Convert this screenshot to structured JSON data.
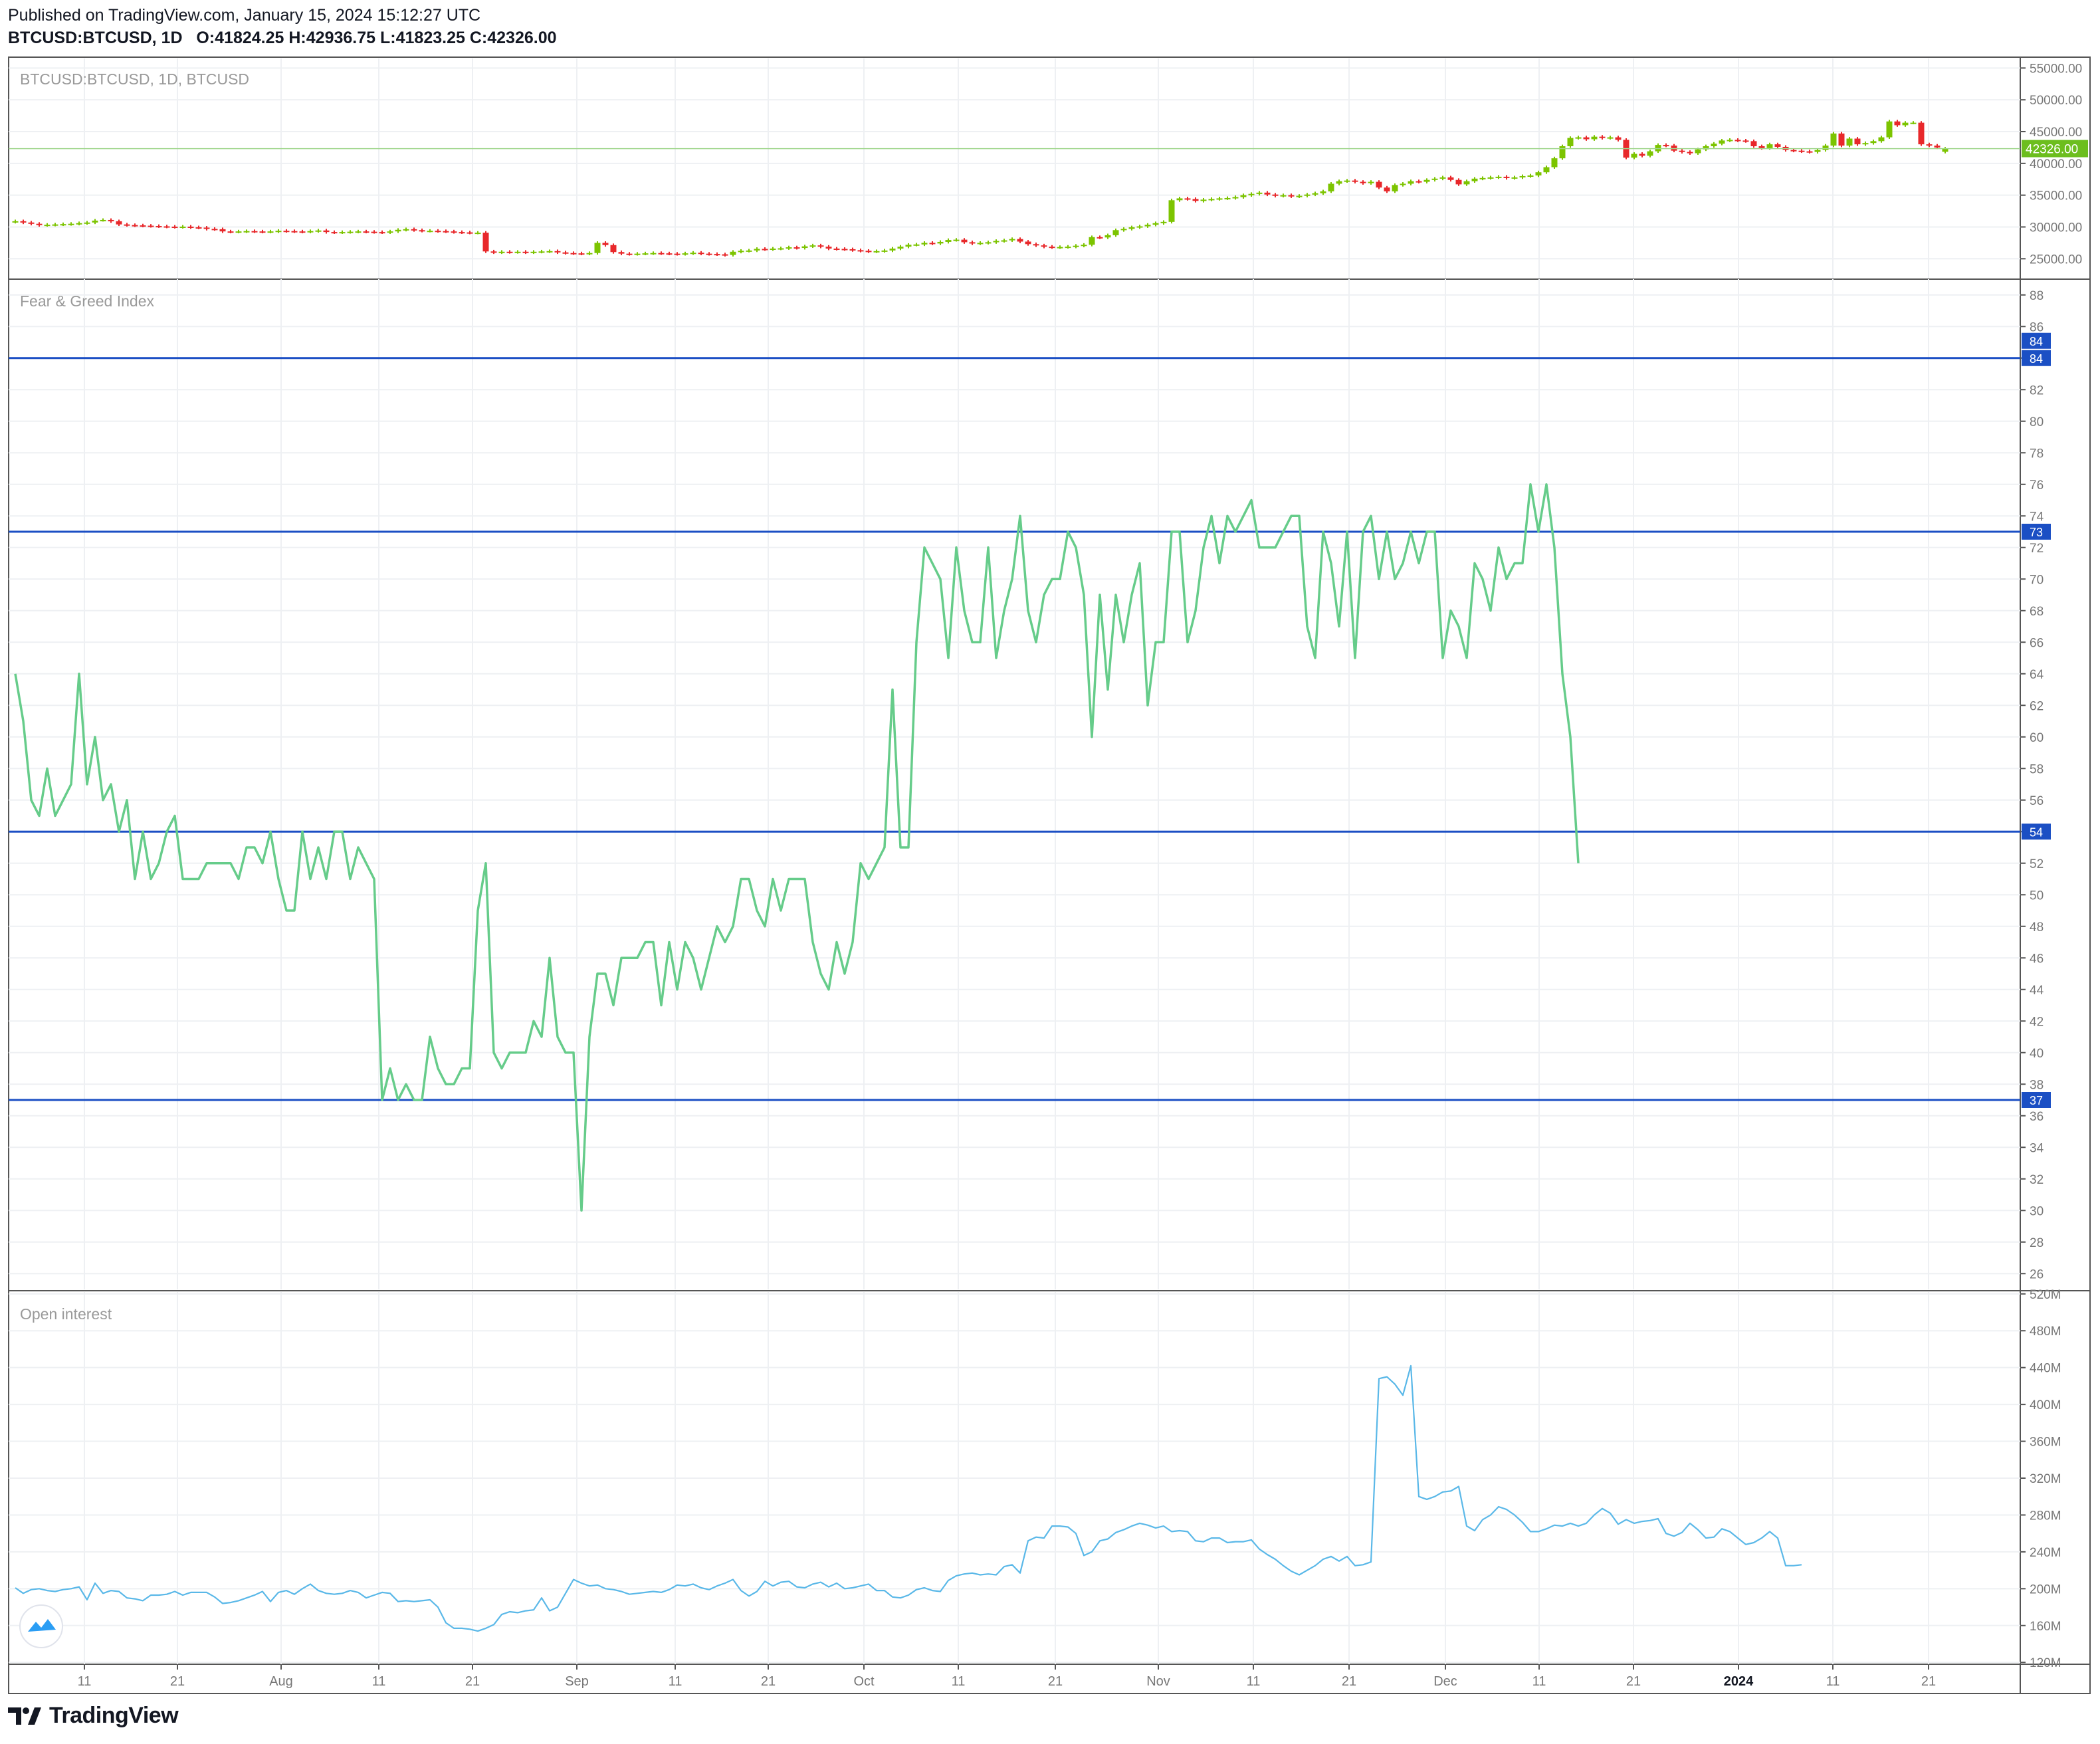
{
  "header": {
    "published": "Published on TradingView.com, January 15, 2024 15:12:27 UTC",
    "symbol": "BTCUSD:BTCUSD, 1D",
    "open_label": "O:",
    "open": "41824.25",
    "high_label": "H:",
    "high": "42936.75",
    "low_label": "L:",
    "low": "41823.25",
    "close_label": "C:",
    "close": "42326.00"
  },
  "footer": {
    "brand": "TradingView",
    "logo_icon": "tradingview-logo-icon"
  },
  "colors": {
    "up": "#7cc400",
    "down": "#e8282b",
    "fg_line": "#66cc8a",
    "hline": "#1b4fc4",
    "oi_line": "#5ab8e8",
    "grid": "#eef0f3",
    "border": "#555555",
    "axis_text": "#777777",
    "price_tag": "#6cbe1e"
  },
  "chart_data": [
    {
      "type": "candlestick",
      "title": "BTCUSD:BTCUSD, 1D, BTCUSD",
      "ylim": [
        22000,
        56500
      ],
      "y_ticks": [
        "25000.00",
        "30000.00",
        "35000.00",
        "40000.00",
        "45000.00",
        "50000.00",
        "55000.00"
      ],
      "last_price_label": "42326.00",
      "last_price": 42326,
      "closes": [
        30900,
        30700,
        30500,
        30300,
        30350,
        30400,
        30450,
        30500,
        30600,
        30700,
        31000,
        31100,
        30900,
        30400,
        30300,
        30250,
        30200,
        30150,
        30100,
        30050,
        30000,
        30050,
        29950,
        29900,
        29700,
        29650,
        29300,
        29250,
        29300,
        29350,
        29300,
        29250,
        29300,
        29400,
        29350,
        29300,
        29250,
        29350,
        29450,
        29200,
        29150,
        29200,
        29250,
        29300,
        29250,
        29200,
        29150,
        29300,
        29550,
        29650,
        29500,
        29400,
        29400,
        29350,
        29300,
        29200,
        29150,
        29100,
        29100,
        26150,
        26000,
        26100,
        26050,
        26100,
        26000,
        26100,
        26150,
        26200,
        26000,
        25900,
        25850,
        25800,
        25900,
        27500,
        27150,
        26050,
        25800,
        25750,
        25800,
        25850,
        25900,
        25850,
        25800,
        25750,
        25850,
        25950,
        25800,
        25750,
        25700,
        25600,
        26100,
        26250,
        26300,
        26550,
        26500,
        26600,
        26650,
        26800,
        26700,
        26950,
        27100,
        26900,
        26600,
        26550,
        26500,
        26350,
        26250,
        26150,
        26200,
        26300,
        26600,
        26900,
        27200,
        27250,
        27500,
        27400,
        27650,
        27950,
        28000,
        27600,
        27400,
        27500,
        27600,
        27800,
        27900,
        28100,
        27700,
        27300,
        27100,
        26900,
        26800,
        26850,
        26900,
        27050,
        27200,
        28400,
        28350,
        28700,
        29500,
        29700,
        29950,
        30100,
        30350,
        30600,
        30800,
        34200,
        34500,
        34400,
        34100,
        34300,
        34400,
        34500,
        34550,
        34700,
        35000,
        35200,
        35400,
        35100,
        34900,
        35000,
        34800,
        34900,
        35100,
        35300,
        35600,
        36800,
        37200,
        37300,
        37100,
        36900,
        37100,
        36200,
        35600,
        36600,
        36800,
        37200,
        37100,
        37400,
        37600,
        37800,
        37400,
        36700,
        37200,
        37600,
        37700,
        37800,
        37900,
        37700,
        37800,
        38000,
        38100,
        38600,
        39400,
        40800,
        42700,
        44000,
        44100,
        43800,
        44200,
        44000,
        44100,
        43700,
        40900,
        41500,
        41200,
        41900,
        42900,
        42800,
        42000,
        41800,
        41600,
        42200,
        42700,
        43100,
        43600,
        43700,
        43600,
        43500,
        42700,
        42400,
        43000,
        42600,
        42100,
        42000,
        41900,
        41800,
        42100,
        42800,
        44700,
        42800,
        43900,
        43000,
        43200,
        43500,
        44100,
        46600,
        46000,
        46400,
        46400,
        43000,
        42800,
        42500,
        42326
      ],
      "opens": [
        30800,
        30900,
        30700,
        30500,
        30300,
        30350,
        30400,
        30450,
        30500,
        30600,
        30700,
        31100,
        31100,
        30900,
        30400,
        30300,
        30250,
        30200,
        30150,
        30100,
        30050,
        30000,
        30050,
        29950,
        29900,
        29700,
        29650,
        29300,
        29250,
        29300,
        29350,
        29300,
        29250,
        29300,
        29400,
        29350,
        29300,
        29250,
        29350,
        29450,
        29200,
        29150,
        29200,
        29250,
        29300,
        29250,
        29200,
        29150,
        29300,
        29550,
        29650,
        29500,
        29400,
        29400,
        29350,
        29300,
        29200,
        29150,
        29100,
        29100,
        26150,
        26000,
        26100,
        26050,
        26100,
        26000,
        26100,
        26150,
        26200,
        26000,
        25900,
        25850,
        25800,
        25900,
        27500,
        27150,
        26050,
        25800,
        25750,
        25800,
        25850,
        25900,
        25850,
        25800,
        25750,
        25850,
        25950,
        25800,
        25750,
        25700,
        25600,
        26100,
        26250,
        26300,
        26550,
        26500,
        26600,
        26650,
        26800,
        26700,
        26950,
        27100,
        26900,
        26600,
        26550,
        26500,
        26350,
        26250,
        26150,
        26200,
        26300,
        26600,
        26900,
        27200,
        27250,
        27500,
        27400,
        27650,
        27950,
        28000,
        27600,
        27400,
        27500,
        27600,
        27800,
        27900,
        28100,
        27700,
        27300,
        27100,
        26900,
        26800,
        26850,
        26900,
        27050,
        27200,
        28400,
        28350,
        28700,
        29500,
        29700,
        29950,
        30100,
        30350,
        30600,
        30800,
        34200,
        34500,
        34400,
        34100,
        34300,
        34400,
        34500,
        34550,
        34700,
        35000,
        35200,
        35400,
        35100,
        34900,
        35000,
        34800,
        34900,
        35100,
        35300,
        35600,
        36800,
        37200,
        37300,
        37100,
        36900,
        37100,
        36200,
        35600,
        36600,
        36800,
        37200,
        37100,
        37400,
        37600,
        37800,
        37400,
        36700,
        37200,
        37600,
        37700,
        37800,
        37900,
        37700,
        37800,
        38000,
        38100,
        38600,
        39400,
        40800,
        42700,
        44000,
        44100,
        43800,
        44200,
        44000,
        44100,
        43700,
        40900,
        41500,
        41200,
        41900,
        42900,
        42800,
        42000,
        41800,
        41600,
        42200,
        42700,
        43100,
        43600,
        43700,
        43600,
        43500,
        42700,
        42400,
        43000,
        42600,
        42100,
        42000,
        41900,
        41800,
        42100,
        42800,
        44700,
        42800,
        43900,
        43000,
        43200,
        43500,
        44100,
        46600,
        46000,
        46400,
        46400,
        43000,
        42800,
        41824
      ]
    },
    {
      "type": "line",
      "title": "Fear & Greed Index",
      "ylim": [
        25,
        89
      ],
      "y_ticks": [
        26,
        28,
        30,
        32,
        34,
        36,
        38,
        40,
        42,
        44,
        46,
        48,
        50,
        52,
        54,
        56,
        58,
        60,
        62,
        64,
        66,
        68,
        70,
        72,
        74,
        76,
        78,
        80,
        82,
        84,
        86,
        88
      ],
      "horizontal_lines": [
        {
          "value": 84,
          "label": "84"
        },
        {
          "value": 73,
          "label": "73"
        },
        {
          "value": 54,
          "label": "54"
        },
        {
          "value": 37,
          "label": "37"
        }
      ],
      "extra_tags": [
        "84"
      ],
      "values": [
        64,
        61,
        56,
        55,
        58,
        55,
        56,
        57,
        64,
        57,
        60,
        56,
        57,
        54,
        56,
        51,
        54,
        51,
        52,
        54,
        55,
        51,
        51,
        51,
        52,
        52,
        52,
        52,
        51,
        53,
        53,
        52,
        54,
        51,
        49,
        49,
        54,
        51,
        53,
        51,
        54,
        54,
        51,
        53,
        52,
        51,
        37,
        39,
        37,
        38,
        37,
        37,
        41,
        39,
        38,
        38,
        39,
        39,
        49,
        52,
        40,
        39,
        40,
        40,
        40,
        42,
        41,
        46,
        41,
        40,
        40,
        30,
        41,
        45,
        45,
        43,
        46,
        46,
        46,
        47,
        47,
        43,
        47,
        44,
        47,
        46,
        44,
        46,
        48,
        47,
        48,
        51,
        51,
        49,
        48,
        51,
        49,
        51,
        51,
        51,
        47,
        45,
        44,
        47,
        45,
        47,
        52,
        51,
        52,
        53,
        63,
        53,
        53,
        66,
        72,
        71,
        70,
        65,
        72,
        68,
        66,
        66,
        72,
        65,
        68,
        70,
        74,
        68,
        66,
        69,
        70,
        70,
        73,
        72,
        69,
        60,
        69,
        63,
        69,
        66,
        69,
        71,
        62,
        66,
        66,
        73,
        73,
        66,
        68,
        72,
        74,
        71,
        74,
        73,
        74,
        75,
        72,
        72,
        72,
        73,
        74,
        74,
        67,
        65,
        73,
        71,
        67,
        73,
        65,
        73,
        74,
        70,
        73,
        70,
        71,
        73,
        71,
        73,
        73,
        65,
        68,
        67,
        65,
        71,
        70,
        68,
        72,
        70,
        71,
        71,
        76,
        73,
        76,
        72,
        64,
        60,
        52
      ]
    },
    {
      "type": "line",
      "title": "Open interest",
      "ylim": [
        118,
        522
      ],
      "y_ticks": [
        "120M",
        "160M",
        "200M",
        "240M",
        "280M",
        "320M",
        "360M",
        "400M",
        "440M",
        "480M",
        "520M"
      ],
      "unit": "M",
      "values": [
        201,
        195,
        199,
        200,
        198,
        197,
        199,
        200,
        202,
        188,
        206,
        195,
        198,
        197,
        190,
        189,
        187,
        193,
        193,
        194,
        197,
        193,
        196,
        196,
        196,
        191,
        184,
        185,
        187,
        190,
        193,
        197,
        186,
        196,
        198,
        194,
        200,
        205,
        198,
        195,
        194,
        195,
        198,
        196,
        190,
        193,
        196,
        195,
        186,
        187,
        186,
        187,
        188,
        180,
        163,
        157,
        157,
        156,
        154,
        157,
        161,
        172,
        175,
        174,
        176,
        177,
        190,
        176,
        180,
        195,
        210,
        206,
        203,
        204,
        200,
        199,
        197,
        194,
        195,
        196,
        197,
        196,
        199,
        204,
        203,
        205,
        201,
        199,
        203,
        206,
        210,
        198,
        192,
        197,
        208,
        203,
        207,
        208,
        202,
        201,
        205,
        207,
        202,
        206,
        200,
        201,
        203,
        205,
        198,
        198,
        191,
        190,
        193,
        199,
        201,
        198,
        197,
        209,
        214,
        216,
        217,
        215,
        216,
        215,
        224,
        226,
        217,
        252,
        256,
        255,
        268,
        268,
        267,
        260,
        236,
        240,
        252,
        254,
        261,
        264,
        268,
        271,
        269,
        266,
        268,
        262,
        263,
        262,
        252,
        251,
        255,
        255,
        250,
        251,
        251,
        253,
        243,
        237,
        232,
        225,
        219,
        215,
        220,
        225,
        232,
        235,
        230,
        235,
        225,
        226,
        229,
        428,
        430,
        422,
        410,
        442,
        300,
        297,
        300,
        305,
        306,
        311,
        268,
        263,
        275,
        280,
        289,
        286,
        280,
        272,
        262,
        262,
        265,
        269,
        268,
        271,
        268,
        271,
        280,
        287,
        282,
        270,
        275,
        271,
        273,
        274,
        276,
        260,
        257,
        261,
        271,
        264,
        255,
        256,
        265,
        262,
        255,
        248,
        250,
        255,
        262,
        255,
        225,
        225,
        226
      ]
    }
  ],
  "x_axis": {
    "labels": [
      "11",
      "21",
      "Aug",
      "11",
      "21",
      "Sep",
      "11",
      "21",
      "Oct",
      "11",
      "21",
      "Nov",
      "11",
      "21",
      "Dec",
      "11",
      "21",
      "2024",
      "11",
      "21"
    ]
  }
}
